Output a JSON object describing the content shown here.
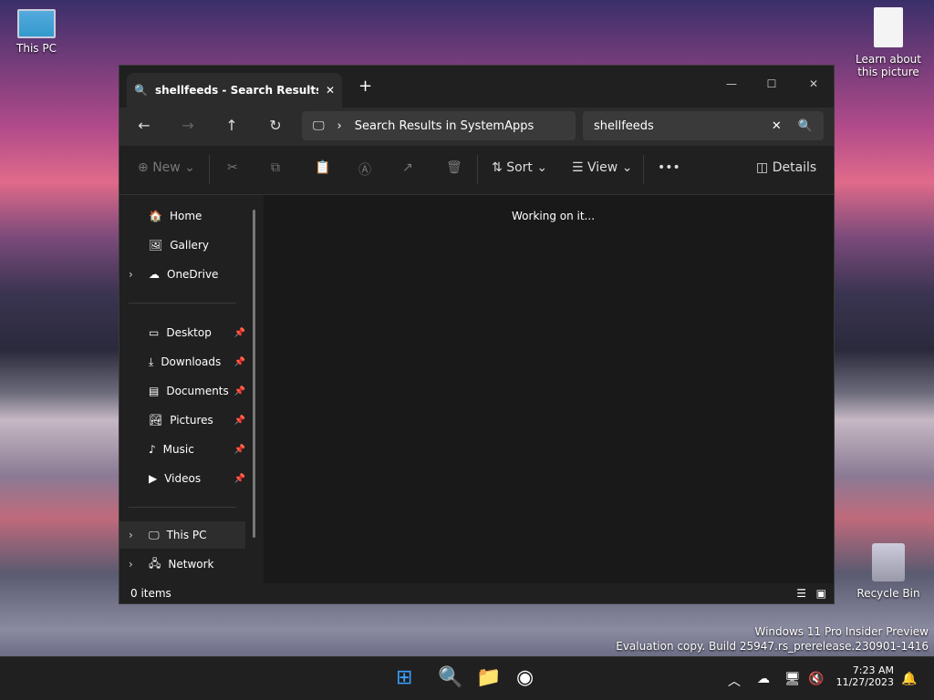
{
  "desktop": {
    "this_pc": "This PC",
    "learn": "Learn about this picture",
    "recycle": "Recycle Bin",
    "watermark1": "Windows 11 Pro Insider Preview",
    "watermark2": "Evaluation copy. Build 25947.rs_prerelease.230901-1416"
  },
  "window": {
    "tab_title": "shellfeeds - Search Results in SystemApps",
    "address": "Search Results in SystemApps",
    "search_value": "shellfeeds",
    "status": "0 items",
    "message": "Working on it..."
  },
  "toolbar": {
    "new": "New",
    "sort": "Sort",
    "view": "View",
    "details": "Details"
  },
  "sidebar": {
    "home": "Home",
    "gallery": "Gallery",
    "onedrive": "OneDrive",
    "desktop": "Desktop",
    "downloads": "Downloads",
    "documents": "Documents",
    "pictures": "Pictures",
    "music": "Music",
    "videos": "Videos",
    "thispc": "This PC",
    "network": "Network"
  },
  "clock": {
    "time": "7:23 AM",
    "date": "11/27/2023"
  }
}
